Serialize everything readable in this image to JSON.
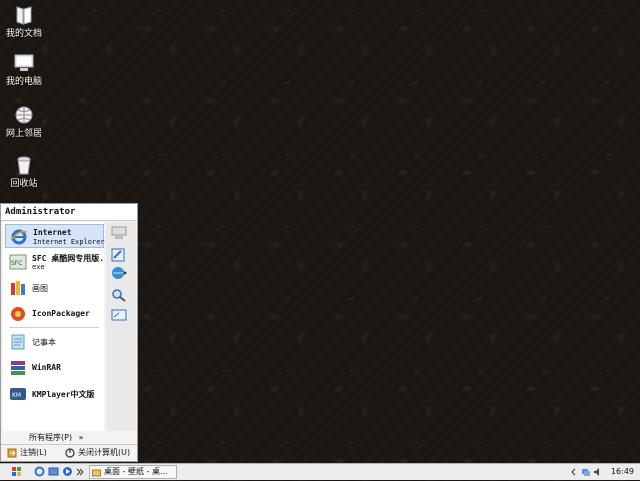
{
  "desktop": {
    "icons": [
      {
        "label": "我的文档",
        "icon": "my-documents-icon"
      },
      {
        "label": "我的电脑",
        "icon": "my-computer-icon"
      },
      {
        "label": "网上邻居",
        "icon": "network-places-icon"
      },
      {
        "label": "回收站",
        "icon": "recycle-bin-icon"
      }
    ]
  },
  "start_menu": {
    "user": "Administrator",
    "pinned": [
      {
        "title": "Internet",
        "subtitle": "Internet Explorer",
        "icon": "internet-explorer-icon"
      },
      {
        "title": "SFC 桌酷网专用版.",
        "subtitle": "exe",
        "icon": "sfc-app-icon"
      }
    ],
    "programs": [
      {
        "label": "画图",
        "icon": "paint-icon"
      },
      {
        "label": "IconPackager",
        "icon": "iconpackager-icon"
      },
      {
        "label": "记事本",
        "icon": "notepad-icon"
      },
      {
        "label": "WinRAR",
        "icon": "winrar-icon"
      },
      {
        "label": "KMPlayer中文版",
        "icon": "kmplayer-icon"
      }
    ],
    "all_programs": "所有程序(P)",
    "all_programs_arrow": "»",
    "logoff": "注销(L)",
    "shutdown": "关闭计算机(U)",
    "right_icons": [
      "my-computer-icon",
      "control-panel-icon",
      "network-icon",
      "search-icon",
      "run-icon"
    ]
  },
  "taskbar": {
    "task_button": "桌面 - 壁纸 - 桌...",
    "clock": "16:49"
  },
  "colors": {
    "desktop_bg": "#1b1612",
    "menu_bg": "#f3f3f3",
    "taskbar_bg": "#ececec",
    "selection": "#d6e4f8"
  }
}
